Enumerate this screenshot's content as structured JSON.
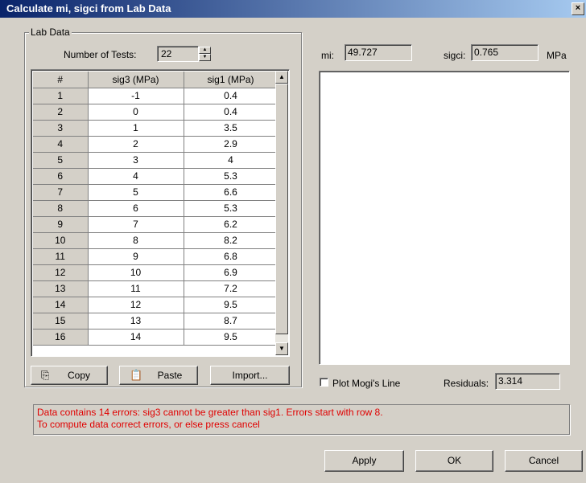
{
  "window": {
    "title": "Calculate mi, sigci from Lab Data",
    "close_glyph": "×"
  },
  "lab_data": {
    "legend": "Lab Data",
    "num_tests_label": "Number of Tests:",
    "num_tests_value": "22",
    "columns": [
      "#",
      "sig3 (MPa)",
      "sig1 (MPa)"
    ],
    "rows": [
      [
        "1",
        "-1",
        "0.4"
      ],
      [
        "2",
        "0",
        "0.4"
      ],
      [
        "3",
        "1",
        "3.5"
      ],
      [
        "4",
        "2",
        "2.9"
      ],
      [
        "5",
        "3",
        "4"
      ],
      [
        "6",
        "4",
        "5.3"
      ],
      [
        "7",
        "5",
        "6.6"
      ],
      [
        "8",
        "6",
        "5.3"
      ],
      [
        "9",
        "7",
        "6.2"
      ],
      [
        "10",
        "8",
        "8.2"
      ],
      [
        "11",
        "9",
        "6.8"
      ],
      [
        "12",
        "10",
        "6.9"
      ],
      [
        "13",
        "11",
        "7.2"
      ],
      [
        "14",
        "12",
        "9.5"
      ],
      [
        "15",
        "13",
        "8.7"
      ],
      [
        "16",
        "14",
        "9.5"
      ]
    ],
    "copy_label": "Copy",
    "paste_label": "Paste",
    "import_label": "Import..."
  },
  "results": {
    "mi_label": "mi:",
    "mi_value": "49.727",
    "sigci_label": "sigci:",
    "sigci_value": "0.765",
    "unit": "MPa",
    "plot_mogi_label": "Plot Mogi's Line",
    "residuals_label": "Residuals:",
    "residuals_value": "3.314"
  },
  "message": {
    "line1": "Data contains 14 errors: sig3 cannot be greater than sig1. Errors start with row 8.",
    "line2": "To compute data correct errors, or else press cancel"
  },
  "footer": {
    "apply_label": "Apply",
    "ok_label": "OK",
    "cancel_label": "Cancel"
  }
}
